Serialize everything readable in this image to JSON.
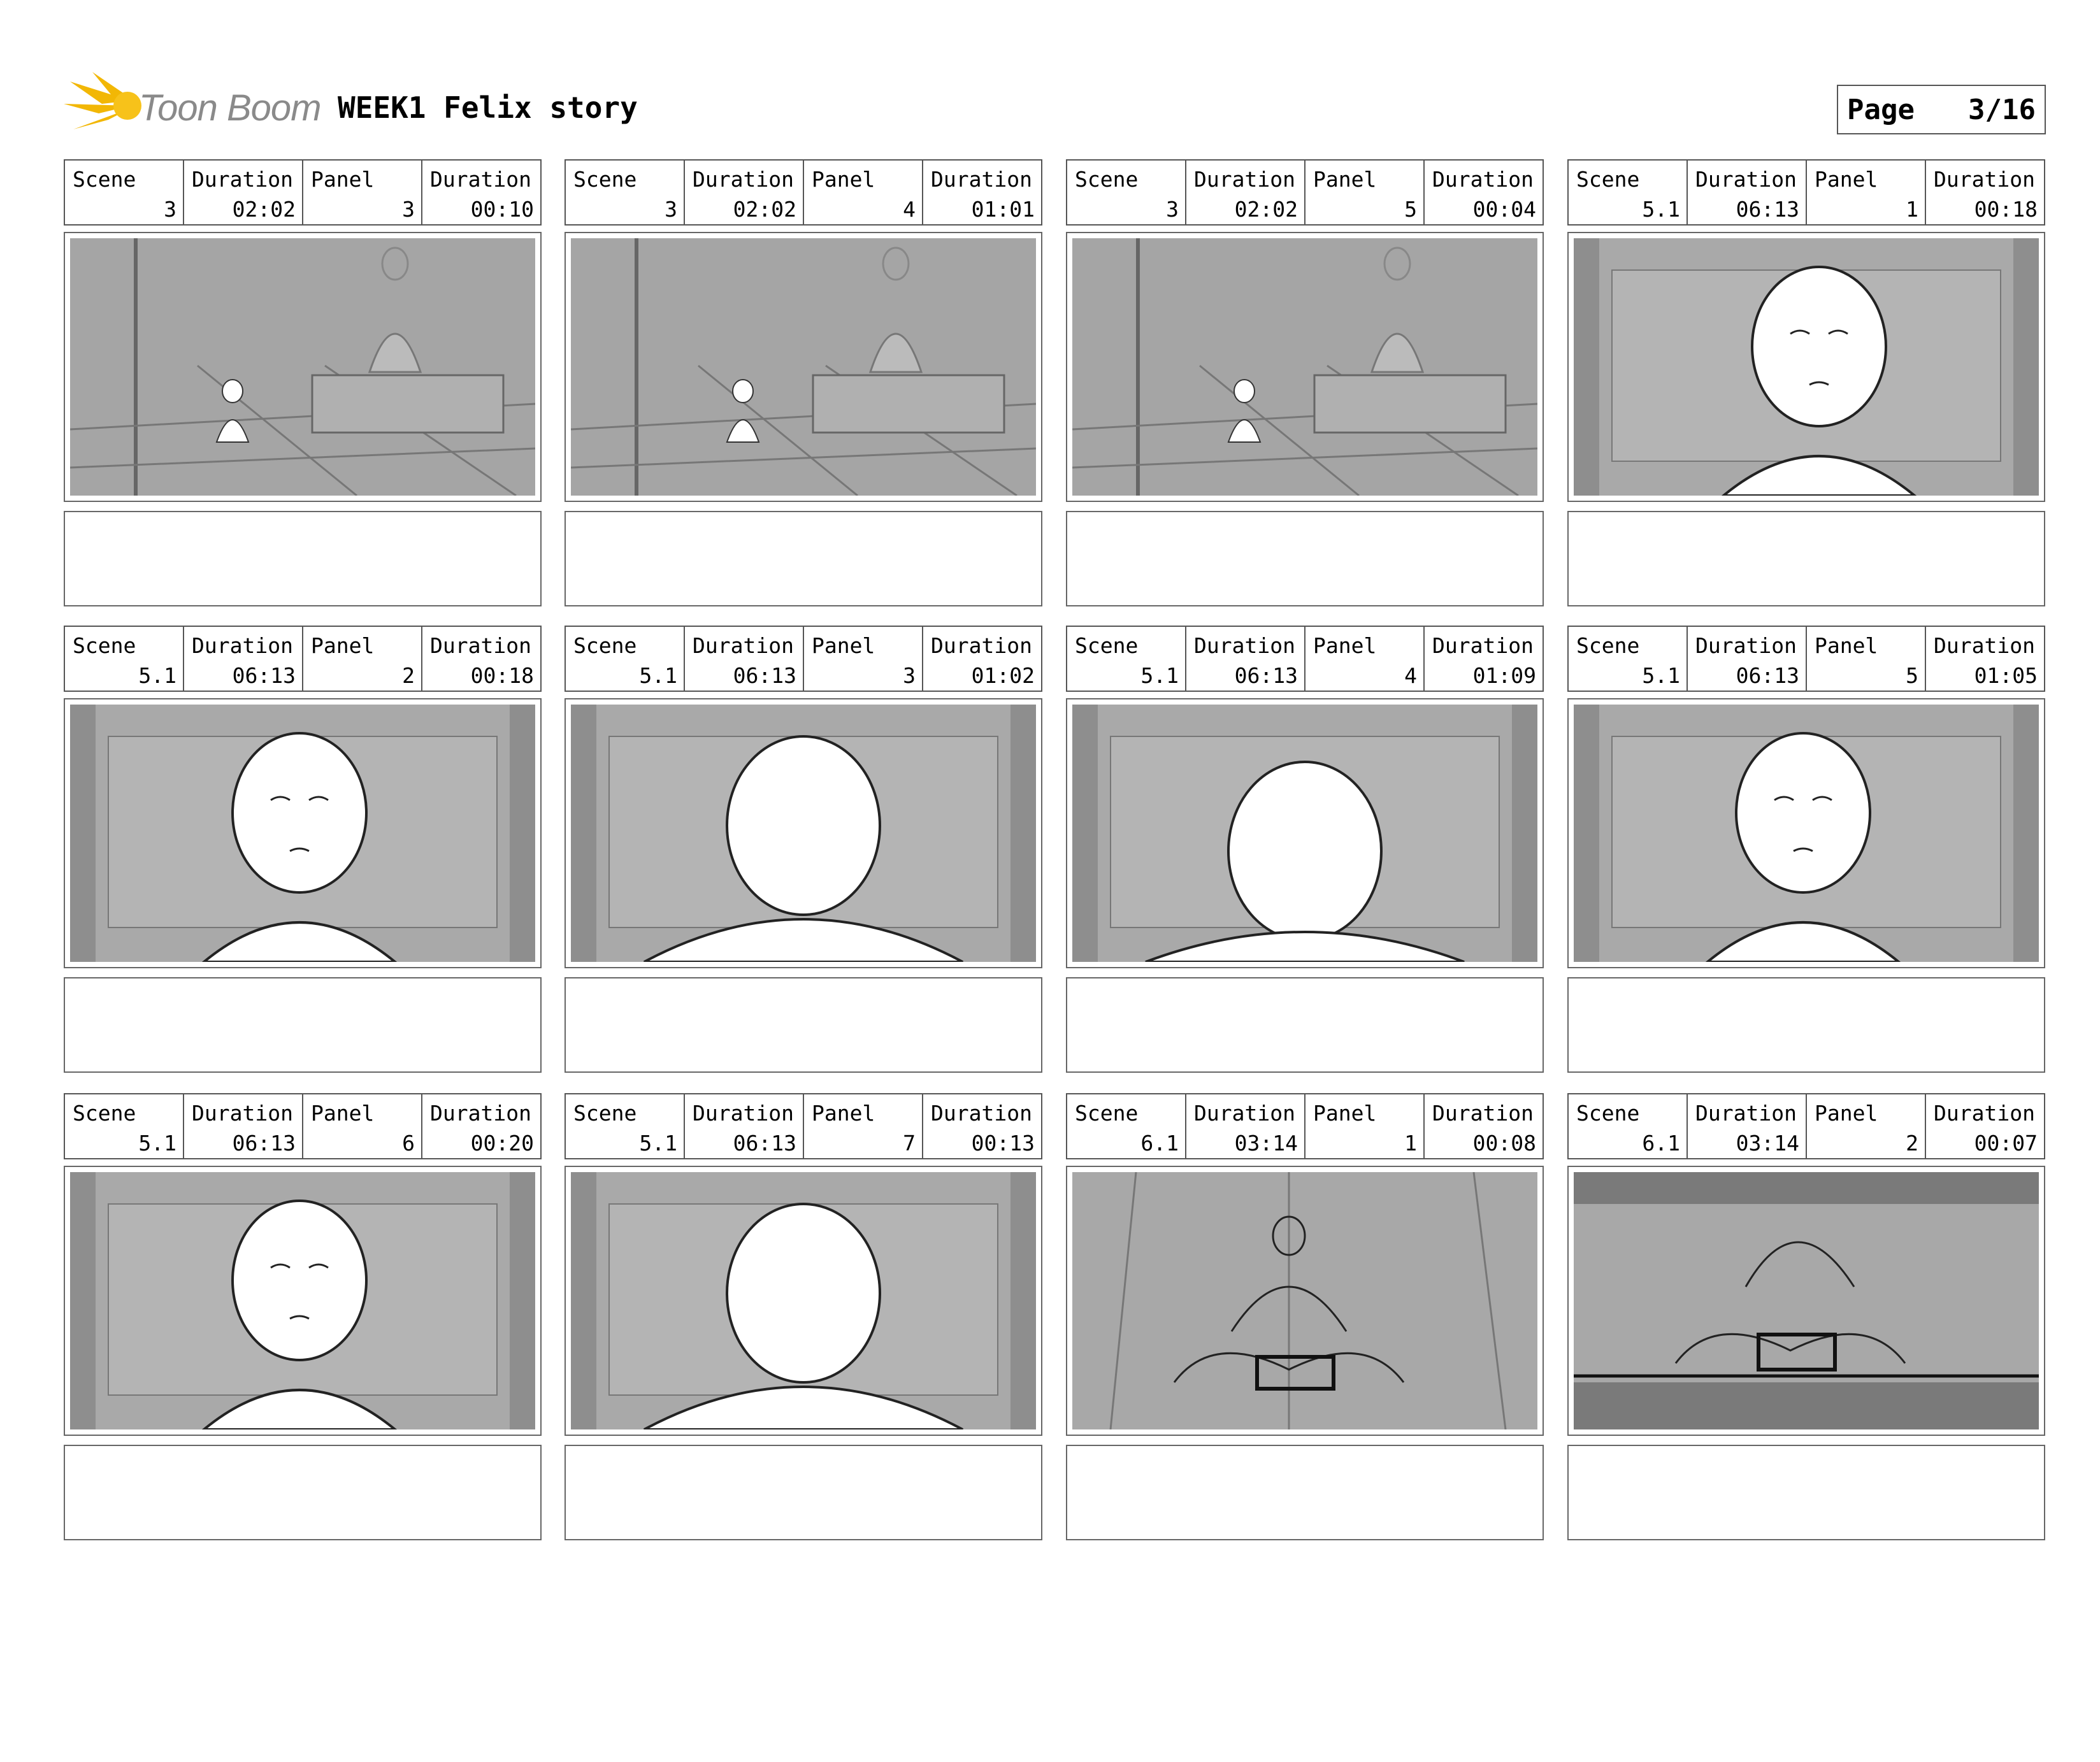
{
  "header": {
    "logo_text": "Toon Boom",
    "story_title": "WEEK1 Felix story",
    "page_label": "Page",
    "page_value": "3/16"
  },
  "labels": {
    "scene": "Scene",
    "duration": "Duration",
    "panel": "Panel"
  },
  "panels": [
    {
      "scene": "3",
      "scene_duration": "02:02",
      "panel": "3",
      "panel_duration": "00:10"
    },
    {
      "scene": "3",
      "scene_duration": "02:02",
      "panel": "4",
      "panel_duration": "01:01"
    },
    {
      "scene": "3",
      "scene_duration": "02:02",
      "panel": "5",
      "panel_duration": "00:04"
    },
    {
      "scene": "5.1",
      "scene_duration": "06:13",
      "panel": "1",
      "panel_duration": "00:18"
    },
    {
      "scene": "5.1",
      "scene_duration": "06:13",
      "panel": "2",
      "panel_duration": "00:18"
    },
    {
      "scene": "5.1",
      "scene_duration": "06:13",
      "panel": "3",
      "panel_duration": "01:02"
    },
    {
      "scene": "5.1",
      "scene_duration": "06:13",
      "panel": "4",
      "panel_duration": "01:09"
    },
    {
      "scene": "5.1",
      "scene_duration": "06:13",
      "panel": "5",
      "panel_duration": "01:05"
    },
    {
      "scene": "5.1",
      "scene_duration": "06:13",
      "panel": "6",
      "panel_duration": "00:20"
    },
    {
      "scene": "5.1",
      "scene_duration": "06:13",
      "panel": "7",
      "panel_duration": "00:13"
    },
    {
      "scene": "6.1",
      "scene_duration": "03:14",
      "panel": "1",
      "panel_duration": "00:08"
    },
    {
      "scene": "6.1",
      "scene_duration": "03:14",
      "panel": "2",
      "panel_duration": "00:07"
    }
  ]
}
